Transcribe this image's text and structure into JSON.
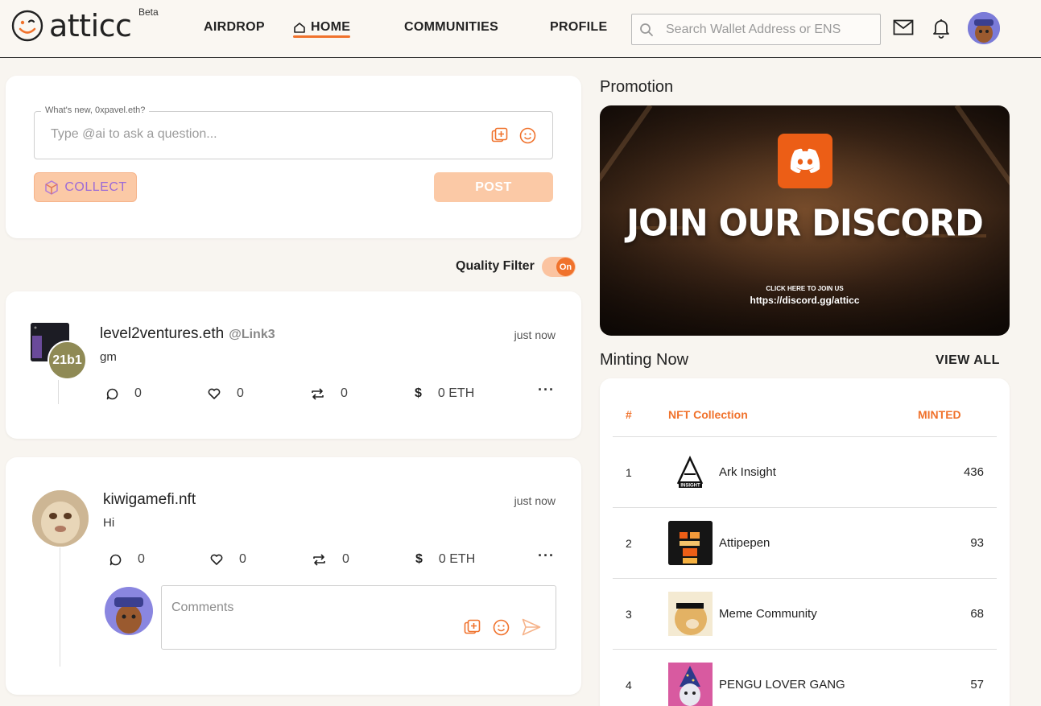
{
  "header": {
    "brand": "atticc",
    "beta": "Beta",
    "nav": [
      {
        "label": "AIRDROP"
      },
      {
        "label": "HOME"
      },
      {
        "label": "COMMUNITIES"
      },
      {
        "label": "PROFILE"
      }
    ],
    "search_placeholder": "Search Wallet Address or ENS",
    "icons": [
      "mail-icon",
      "bell-icon"
    ]
  },
  "composer": {
    "legend": "What's new, 0xpavel.eth?",
    "placeholder": "Type @ai to ask a question...",
    "collect_label": "COLLECT",
    "post_label": "POST"
  },
  "quality_filter": {
    "label": "Quality Filter",
    "state": "On"
  },
  "posts": [
    {
      "name": "level2ventures.eth",
      "handle": "@Link3",
      "time": "just now",
      "body": "gm",
      "badge": "21b1",
      "comments": "0",
      "likes": "0",
      "reposts": "0",
      "tips": "0 ETH"
    },
    {
      "name": "kiwigamefi.nft",
      "time": "just now",
      "body": "Hi",
      "comments": "0",
      "likes": "0",
      "reposts": "0",
      "tips": "0 ETH",
      "comment_placeholder": "Comments"
    }
  ],
  "promotion": {
    "title": "Promotion",
    "headline": "JOIN OUR DISCORD",
    "cta": "CLICK HERE TO JOIN US",
    "url": "https://discord.gg/atticc"
  },
  "minting": {
    "title": "Minting Now",
    "view_all": "VIEW ALL",
    "columns": [
      "#",
      "NFT Collection",
      "MINTED"
    ],
    "rows": [
      {
        "rank": "1",
        "name": "Ark Insight",
        "minted": "436",
        "thumb_label": "INSIGHT"
      },
      {
        "rank": "2",
        "name": "Attipepen",
        "minted": "93"
      },
      {
        "rank": "3",
        "name": "Meme Community",
        "minted": "68"
      },
      {
        "rank": "4",
        "name": "PENGU LOVER GANG",
        "minted": "57"
      }
    ]
  },
  "colors": {
    "accent": "#f0722c",
    "button_bg": "#fbc9a6",
    "background": "#f8f5f0"
  }
}
